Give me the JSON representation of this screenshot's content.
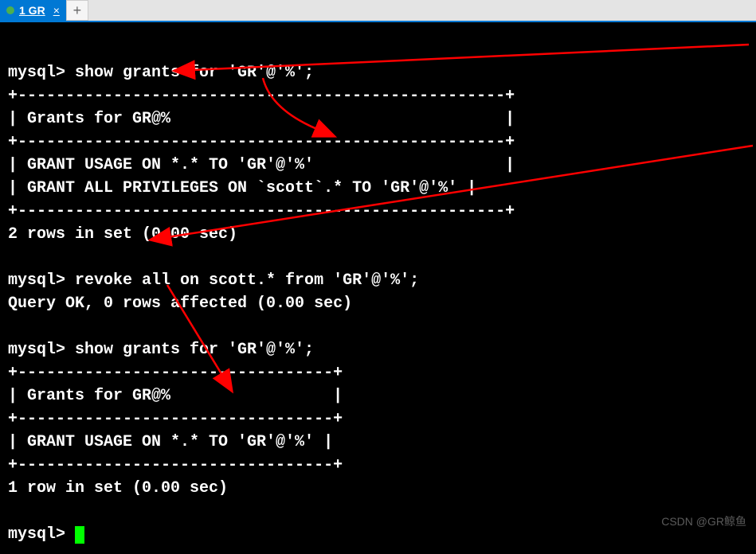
{
  "tab": {
    "title": "1 GR",
    "close": "×",
    "add": "+"
  },
  "terminal": {
    "lines": [
      "mysql> show grants for 'GR'@'%';",
      "+---------------------------------------------------+",
      "| Grants for GR@%                                   |",
      "+---------------------------------------------------+",
      "| GRANT USAGE ON *.* TO 'GR'@'%'                    |",
      "| GRANT ALL PRIVILEGES ON `scott`.* TO 'GR'@'%' |",
      "+---------------------------------------------------+",
      "2 rows in set (0.00 sec)",
      "",
      "mysql> revoke all on scott.* from 'GR'@'%';",
      "Query OK, 0 rows affected (0.00 sec)",
      "",
      "mysql> show grants for 'GR'@'%';",
      "+---------------------------------+",
      "| Grants for GR@%                 |",
      "+---------------------------------+",
      "| GRANT USAGE ON *.* TO 'GR'@'%' |",
      "+---------------------------------+",
      "1 row in set (0.00 sec)",
      "",
      "mysql> "
    ],
    "prompt_cursor": "█"
  },
  "watermark": "CSDN @GR鲸鱼",
  "arrows": {
    "color": "#ff0000"
  }
}
